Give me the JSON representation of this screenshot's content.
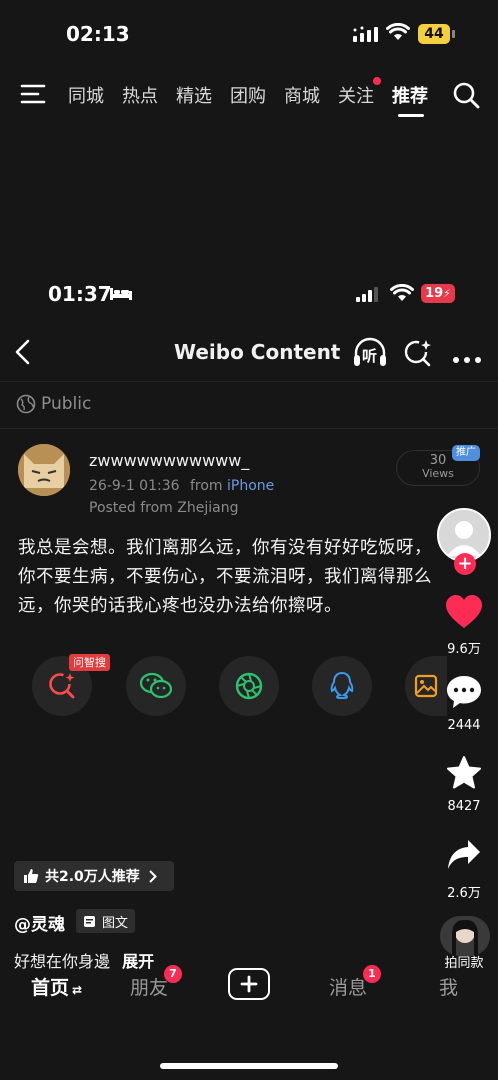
{
  "status_bar": {
    "time": "02:13",
    "battery": "44"
  },
  "top_nav": {
    "tabs": [
      {
        "label": "同城"
      },
      {
        "label": "热点"
      },
      {
        "label": "精选"
      },
      {
        "label": "团购"
      },
      {
        "label": "商城"
      },
      {
        "label": "关注"
      },
      {
        "label": "推荐"
      }
    ],
    "active_index": 6
  },
  "inner_status_bar": {
    "time": "01:37",
    "battery": "19"
  },
  "weibo_header": {
    "title": "Weibo Content",
    "listen_label": "听"
  },
  "visibility": "Public",
  "post": {
    "username": "zwwwwwwwwwww_",
    "date": "26-9-1 01:36",
    "from_label": "from",
    "device": "iPhone",
    "posted_from": "Posted from Zhejiang",
    "views_count": "30",
    "views_label": "Views",
    "promo_badge": "推广",
    "text": "我总是会想。我们离那么远，你有没有好好吃饭呀，你不要生病，不要伤心，不要流泪呀，我们离得那么远，你哭的话我心疼也没办法给你擦呀。",
    "share_badge": "问智搜"
  },
  "right_rail": {
    "likes": "9.6万",
    "comments": "2444",
    "favorites": "8427",
    "shares": "2.6万",
    "same_style": "拍同款"
  },
  "recommend": {
    "label": "共2.0万人推荐"
  },
  "author": {
    "handle": "@灵魂",
    "tag": "图文"
  },
  "caption": {
    "text": "好想在你身邊",
    "expand": "展开"
  },
  "bottom_nav": {
    "home": "首页",
    "friends": "朋友",
    "friends_badge": "7",
    "messages": "消息",
    "messages_badge": "1",
    "me": "我"
  }
}
